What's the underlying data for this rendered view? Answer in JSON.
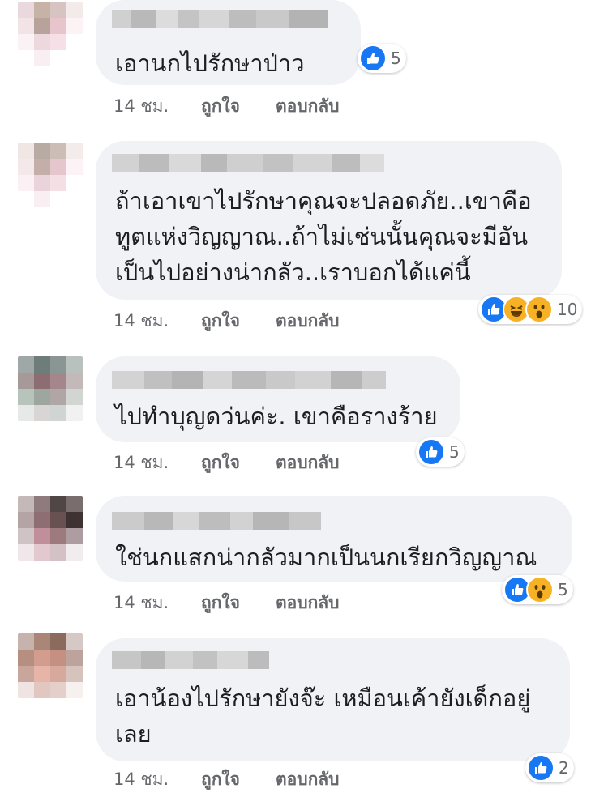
{
  "comments": [
    {
      "text": "เอานกไปรักษาป่าว",
      "time": "14 ชม.",
      "like": "ถูกใจ",
      "reply": "ตอบกลับ",
      "reactions": [
        "like-icon"
      ],
      "reaction_count": "5"
    },
    {
      "text": "ถ้าเอาเขาไปรักษาคุณจะปลอดภัย..เขาคือ\nทูตแห่งวิญญาณ..ถ้าไม่เช่นนั้นคุณจะมีอัน\nเป็นไปอย่างน่ากลัว..เราบอกได้แค่นี้",
      "time": "14 ชม.",
      "like": "ถูกใจ",
      "reply": "ตอบกลับ",
      "reactions": [
        "like-icon",
        "haha-icon",
        "wow-icon"
      ],
      "reaction_count": "10"
    },
    {
      "text": "ไปทำบุญดว่นค่ะ. เขาคือรางร้าย",
      "time": "14 ชม.",
      "like": "ถูกใจ",
      "reply": "ตอบกลับ",
      "reactions": [
        "like-icon"
      ],
      "reaction_count": "5"
    },
    {
      "text": "ใช่นกแสกน่ากลัวมากเป็นนกเรียกวิญญาณ",
      "time": "14 ชม.",
      "like": "ถูกใจ",
      "reply": "ตอบกลับ",
      "reactions": [
        "like-icon",
        "wow-icon"
      ],
      "reaction_count": "5"
    },
    {
      "text": "เอาน้องไปรักษายังจ๊ะ เหมือนเค้ายังเด็กอยู่\nเลย",
      "time": "14 ชม.",
      "like": "ถูกใจ",
      "reply": "ตอบกลับ",
      "reactions": [
        "like-icon"
      ],
      "reaction_count": "2"
    }
  ],
  "colors": {
    "bubble": "#f0f2f5",
    "meta_text": "#65676b",
    "like_blue": "#1877f2",
    "emoji_yellow": "#f7b125"
  }
}
